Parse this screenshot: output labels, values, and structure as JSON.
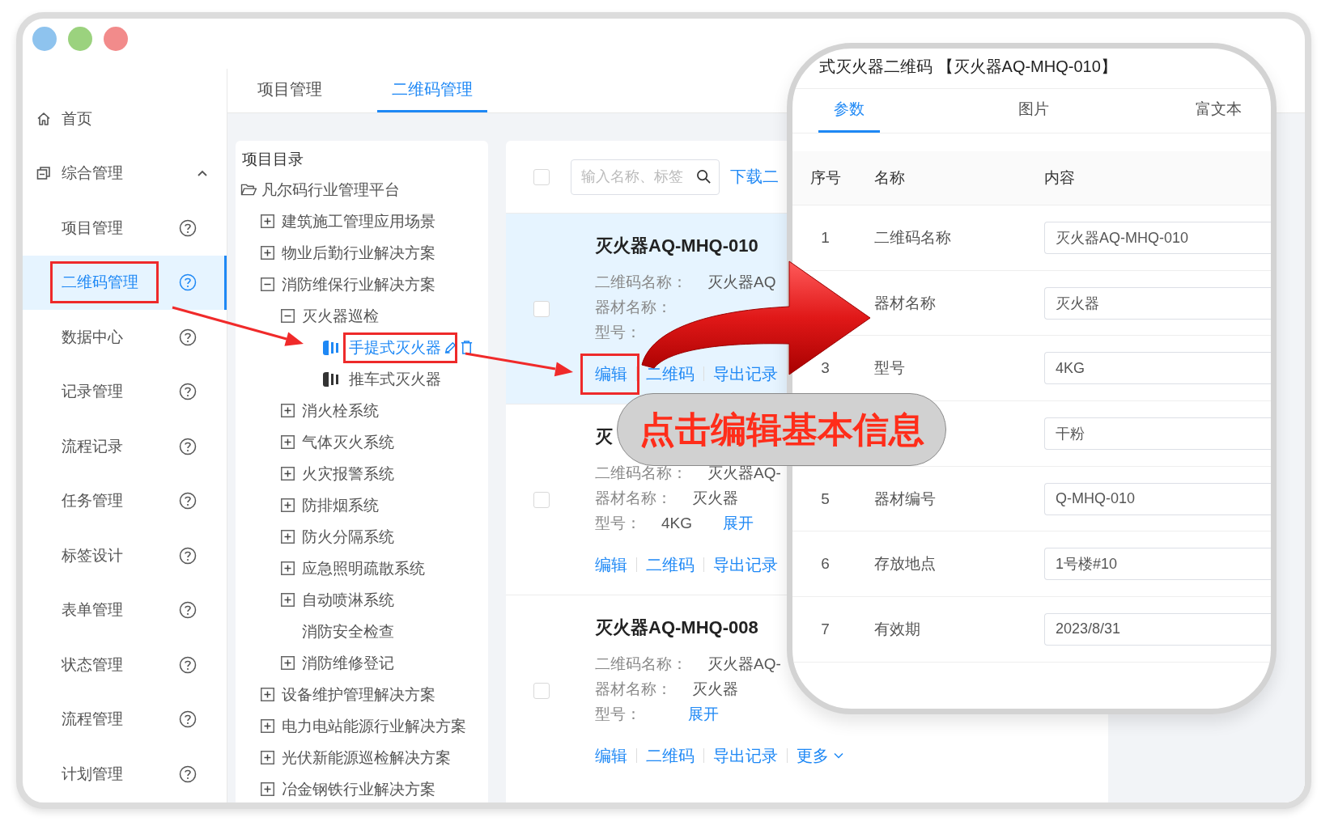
{
  "window": {
    "controls": [
      {
        "color": "#8ec3ee"
      },
      {
        "color": "#9bd27e"
      },
      {
        "color": "#f28b8b"
      }
    ]
  },
  "sidebar": {
    "items": [
      {
        "kind": "link",
        "label": "首页",
        "selected": false
      },
      {
        "kind": "group",
        "label": "综合管理",
        "expanded": true,
        "selected": false,
        "children": [
          {
            "label": "项目管理",
            "selected": false,
            "boxed": false
          },
          {
            "label": "二维码管理",
            "selected": true,
            "boxed": true
          },
          {
            "label": "数据中心",
            "selected": false,
            "boxed": false
          },
          {
            "label": "记录管理",
            "selected": false,
            "boxed": false
          },
          {
            "label": "流程记录",
            "selected": false,
            "boxed": false
          },
          {
            "label": "任务管理",
            "selected": false,
            "boxed": false
          },
          {
            "label": "标签设计",
            "selected": false,
            "boxed": false
          },
          {
            "label": "表单管理",
            "selected": false,
            "boxed": false
          },
          {
            "label": "状态管理",
            "selected": false,
            "boxed": false
          },
          {
            "label": "流程管理",
            "selected": false,
            "boxed": false
          },
          {
            "label": "计划管理",
            "selected": false,
            "boxed": false
          }
        ]
      }
    ]
  },
  "tabs": [
    {
      "label": "项目管理",
      "selected": false
    },
    {
      "label": "二维码管理",
      "selected": true
    }
  ],
  "tree": {
    "title": "项目目录",
    "nodes": [
      {
        "kind": "folder",
        "label": "凡尔码行业管理平台",
        "expanded": true,
        "children": [
          {
            "kind": "group",
            "label": "建筑施工管理应用场景",
            "expanded": false
          },
          {
            "kind": "group",
            "label": "物业后勤行业解决方案",
            "expanded": false
          },
          {
            "kind": "group",
            "label": "消防维保行业解决方案",
            "expanded": true,
            "children": [
              {
                "kind": "group",
                "label": "灭火器巡检",
                "expanded": true,
                "children": [
                  {
                    "kind": "device",
                    "label": "手提式灭火器",
                    "selected": true,
                    "boxed": true
                  },
                  {
                    "kind": "device",
                    "label": "推车式灭火器",
                    "selected": false,
                    "boxed": false
                  }
                ]
              },
              {
                "kind": "group",
                "label": "消火栓系统",
                "expanded": false
              },
              {
                "kind": "group",
                "label": "气体灭火系统",
                "expanded": false
              },
              {
                "kind": "group",
                "label": "火灾报警系统",
                "expanded": false
              },
              {
                "kind": "group",
                "label": "防排烟系统",
                "expanded": false
              },
              {
                "kind": "group",
                "label": "防火分隔系统",
                "expanded": false
              },
              {
                "kind": "group",
                "label": "应急照明疏散系统",
                "expanded": false
              },
              {
                "kind": "group",
                "label": "自动喷淋系统",
                "expanded": false
              },
              {
                "kind": "plain",
                "label": "消防安全检查"
              },
              {
                "kind": "group",
                "label": "消防维修登记",
                "expanded": false
              }
            ]
          },
          {
            "kind": "group",
            "label": "设备维护管理解决方案",
            "expanded": false
          },
          {
            "kind": "group",
            "label": "电力电站能源行业解决方案",
            "expanded": false
          },
          {
            "kind": "group",
            "label": "光伏新能源巡检解决方案",
            "expanded": false
          },
          {
            "kind": "group",
            "label": "冶金钢铁行业解决方案",
            "expanded": false
          }
        ]
      }
    ]
  },
  "list": {
    "select_all": {
      "checked": false
    },
    "search": {
      "placeholder": "输入名称、标签"
    },
    "download_link": "下载二",
    "cards": [
      {
        "title": "灭火器AQ-MHQ-010",
        "selected": true,
        "checked": false,
        "fields": [
          {
            "label": "二维码名称：",
            "value": "灭火器AQ"
          },
          {
            "label": "器材名称："
          },
          {
            "label": "型号："
          }
        ],
        "actions": [
          {
            "kind": "link",
            "label": "编辑",
            "boxed": true
          },
          {
            "kind": "link",
            "label": "二维码",
            "boxed": false
          },
          {
            "kind": "link",
            "label": "导出记录",
            "boxed": false
          }
        ]
      },
      {
        "title": "灭",
        "selected": false,
        "checked": false,
        "fields": [
          {
            "label": "二维码名称：",
            "value": "灭火器AQ-"
          },
          {
            "label": "器材名称：",
            "value": "灭火器"
          },
          {
            "label": "型号：",
            "value": "4KG",
            "link": "展开"
          }
        ],
        "actions": [
          {
            "kind": "link",
            "label": "编辑",
            "boxed": false
          },
          {
            "kind": "link",
            "label": "二维码",
            "boxed": false
          },
          {
            "kind": "link",
            "label": "导出记录",
            "boxed": false
          }
        ]
      },
      {
        "title": "灭火器AQ-MHQ-008",
        "selected": false,
        "checked": false,
        "fields": [
          {
            "label": "二维码名称：",
            "value": "灭火器AQ-"
          },
          {
            "label": "器材名称：",
            "value": "灭火器"
          },
          {
            "label": "型号：",
            "link": "展开"
          }
        ],
        "actions": [
          {
            "kind": "link",
            "label": "编辑",
            "boxed": false
          },
          {
            "kind": "link",
            "label": "二维码",
            "boxed": false
          },
          {
            "kind": "link",
            "label": "导出记录",
            "boxed": false
          },
          {
            "kind": "menu",
            "label": "更多",
            "boxed": false
          }
        ]
      }
    ]
  },
  "detail": {
    "title": "式灭火器二维码 【灭火器AQ-MHQ-010】",
    "tabs": [
      {
        "label": "参数",
        "selected": true
      },
      {
        "label": "图片",
        "selected": false
      },
      {
        "label": "富文本",
        "selected": false
      }
    ],
    "columns": [
      "序号",
      "名称",
      "内容"
    ],
    "rows": [
      {
        "index": "1",
        "name": "二维码名称",
        "value": "灭火器AQ-MHQ-010"
      },
      {
        "name": "器材名称",
        "value": "灭火器"
      },
      {
        "index": "3",
        "name": "型号",
        "value": "4KG"
      },
      {
        "value": "干粉"
      },
      {
        "index": "5",
        "name": "器材编号",
        "value": "Q-MHQ-010"
      },
      {
        "index": "6",
        "name": "存放地点",
        "value": "1号楼#10"
      },
      {
        "index": "7",
        "name": "有效期",
        "value": "2023/8/31"
      }
    ]
  },
  "callout": {
    "text": "点击编辑基本信息"
  }
}
